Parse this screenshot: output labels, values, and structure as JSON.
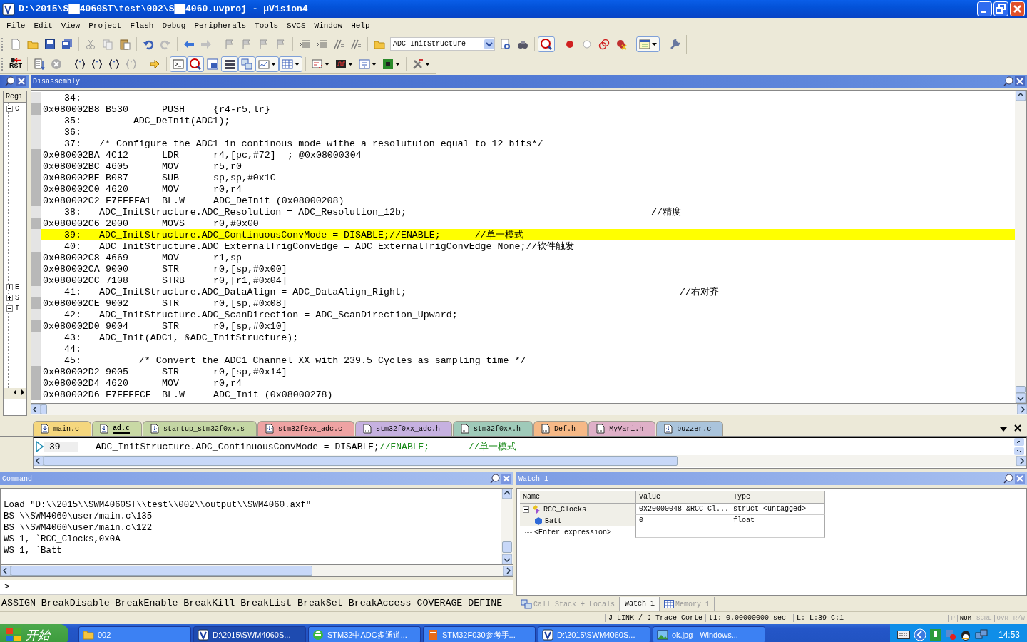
{
  "window": {
    "title": "D:\\2015\\S██4060ST\\test\\002\\S██4060.uvproj - µVision4"
  },
  "menu": [
    "File",
    "Edit",
    "View",
    "Project",
    "Flash",
    "Debug",
    "Peripherals",
    "Tools",
    "SVCS",
    "Window",
    "Help"
  ],
  "toolbar": {
    "combo_value": "ADC_InitStructure",
    "reset_label": "RST"
  },
  "registers_panel": {
    "tab": "Regi",
    "tree": [
      {
        "label": "C",
        "expanded": true
      },
      {
        "label": "E",
        "expanded": false
      },
      {
        "label": "S",
        "expanded": false
      },
      {
        "label": "I",
        "expanded": true
      }
    ]
  },
  "disassembly": {
    "title": "Disassembly",
    "lines": [
      {
        "kind": "src",
        "num": "34:",
        "selected": false
      },
      {
        "kind": "asm",
        "address": "0x080002B8",
        "opcode": "B530",
        "mnemonic": "PUSH",
        "operands": "{r4-r5,lr}",
        "selected": false
      },
      {
        "kind": "src",
        "num": "35:",
        "text": "      ADC_DeInit(ADC1);",
        "selected": false
      },
      {
        "kind": "src",
        "num": "36:",
        "selected": false
      },
      {
        "kind": "src",
        "num": "37:",
        "text": "/* Configure the ADC1 in continous mode withe a resolutuion equal to 12 bits*/",
        "selected": false
      },
      {
        "kind": "asm",
        "address": "0x080002BA",
        "opcode": "4C12",
        "mnemonic": "LDR",
        "operands": "r4,[pc,#72]",
        "comment": "; @0x08000304",
        "selected": false
      },
      {
        "kind": "asm",
        "address": "0x080002BC",
        "opcode": "4605",
        "mnemonic": "MOV",
        "operands": "r5,r0",
        "selected": false
      },
      {
        "kind": "asm",
        "address": "0x080002BE",
        "opcode": "B087",
        "mnemonic": "SUB",
        "operands": "sp,sp,#0x1C",
        "selected": false
      },
      {
        "kind": "asm",
        "address": "0x080002C0",
        "opcode": "4620",
        "mnemonic": "MOV",
        "operands": "r0,r4",
        "selected": false
      },
      {
        "kind": "asm",
        "address": "0x080002C2",
        "opcode": "F7FFFFA1",
        "mnemonic": "BL.W",
        "operands": "ADC_DeInit (0x08000208)",
        "selected": false
      },
      {
        "kind": "src",
        "num": "38:",
        "text": "ADC_InitStructure.ADC_Resolution = ADC_Resolution_12b;                                           //精度",
        "selected": false
      },
      {
        "kind": "asm",
        "address": "0x080002C6",
        "opcode": "2000",
        "mnemonic": "MOVS",
        "operands": "r0,#0x00",
        "selected": false
      },
      {
        "kind": "src",
        "num": "39:",
        "text": "ADC_InitStructure.ADC_ContinuousConvMode = DISABLE;//ENABLE;      //单一模式",
        "selected": true
      },
      {
        "kind": "src",
        "num": "40:",
        "text": "ADC_InitStructure.ADC_ExternalTrigConvEdge = ADC_ExternalTrigConvEdge_None;//软件触发",
        "selected": false
      },
      {
        "kind": "asm",
        "address": "0x080002C8",
        "opcode": "4669",
        "mnemonic": "MOV",
        "operands": "r1,sp",
        "selected": false
      },
      {
        "kind": "asm",
        "address": "0x080002CA",
        "opcode": "9000",
        "mnemonic": "STR",
        "operands": "r0,[sp,#0x00]",
        "selected": false
      },
      {
        "kind": "asm",
        "address": "0x080002CC",
        "opcode": "7108",
        "mnemonic": "STRB",
        "operands": "r0,[r1,#0x04]",
        "selected": false
      },
      {
        "kind": "src",
        "num": "41:",
        "text": "ADC_InitStructure.ADC_DataAlign = ADC_DataAlign_Right;                                                //右对齐",
        "selected": false
      },
      {
        "kind": "asm",
        "address": "0x080002CE",
        "opcode": "9002",
        "mnemonic": "STR",
        "operands": "r0,[sp,#0x08]",
        "selected": false
      },
      {
        "kind": "src",
        "num": "42:",
        "text": "ADC_InitStructure.ADC_ScanDirection = ADC_ScanDirection_Upward;",
        "selected": false
      },
      {
        "kind": "asm",
        "address": "0x080002D0",
        "opcode": "9004",
        "mnemonic": "STR",
        "operands": "r0,[sp,#0x10]",
        "selected": false
      },
      {
        "kind": "src",
        "num": "43:",
        "text": "ADC_Init(ADC1, &ADC_InitStructure);",
        "selected": false
      },
      {
        "kind": "src",
        "num": "44:",
        "selected": false
      },
      {
        "kind": "src",
        "num": "45:",
        "text": "       /* Convert the ADC1 Channel XX with 239.5 Cycles as sampling time */",
        "selected": false
      },
      {
        "kind": "asm",
        "address": "0x080002D2",
        "opcode": "9005",
        "mnemonic": "STR",
        "operands": "r0,[sp,#0x14]",
        "selected": false
      },
      {
        "kind": "asm",
        "address": "0x080002D4",
        "opcode": "4620",
        "mnemonic": "MOV",
        "operands": "r0,r4",
        "selected": false
      },
      {
        "kind": "asm",
        "address": "0x080002D6",
        "opcode": "F7FFFFCF",
        "mnemonic": "BL.W",
        "operands": "ADC_Init (0x08000278)",
        "selected": false
      }
    ]
  },
  "file_tabs": [
    {
      "label": "main.c",
      "kind": "c",
      "color": "#f5d77e",
      "selected": false
    },
    {
      "label": "ad.c",
      "kind": "c",
      "color": "#c9d9a5",
      "selected": true
    },
    {
      "label": "startup_stm32f0xx.s",
      "kind": "c",
      "color": "#c4d6a4",
      "selected": false
    },
    {
      "label": "stm32f0xx_adc.c",
      "kind": "c",
      "color": "#eea3a3",
      "selected": false
    },
    {
      "label": "stm32f0xx_adc.h",
      "kind": "h",
      "color": "#c6b1e0",
      "selected": false
    },
    {
      "label": "stm32f0xx.h",
      "kind": "h",
      "color": "#9fcab9",
      "selected": false
    },
    {
      "label": "Def.h",
      "kind": "h",
      "color": "#f6b987",
      "selected": false
    },
    {
      "label": "MyVari.h",
      "kind": "h",
      "color": "#dfb0c8",
      "selected": false
    },
    {
      "label": "buzzer.c",
      "kind": "c",
      "color": "#aac4dc",
      "selected": false
    }
  ],
  "editor": {
    "line_number": "39",
    "code": "ADC_InitStructure.ADC_ContinuousConvMode = DISABLE;",
    "comment": "//ENABLE;       //单一模式"
  },
  "command": {
    "title": "Command",
    "output": [
      "Load \"D:\\\\2015\\\\SWM4060ST\\\\test\\\\002\\\\output\\\\SWM4060.axf\"",
      "BS \\\\SWM4060\\user/main.c\\135",
      "BS \\\\SWM4060\\user/main.c\\122",
      "WS 1, `RCC_Clocks,0x0A",
      "WS 1, `Batt"
    ],
    "prompt": ">",
    "hints": "ASSIGN BreakDisable BreakEnable BreakKill BreakList BreakSet BreakAccess COVERAGE DEFINE"
  },
  "watch": {
    "title": "Watch 1",
    "columns": [
      "Name",
      "Value",
      "Type"
    ],
    "rows": [
      {
        "kind": "struct",
        "name": "RCC_Clocks",
        "value": "0x20000048 &RCC_Cl...",
        "type": "struct <untagged>",
        "expanded": false
      },
      {
        "kind": "var",
        "name": "Batt",
        "value": "0",
        "type": "float"
      },
      {
        "kind": "placeholder",
        "name": "<Enter expression>"
      }
    ]
  },
  "bottom_tabs": [
    {
      "label": "Call Stack + Locals",
      "kind": "stack",
      "selected": false
    },
    {
      "label": "Watch 1",
      "kind": "watch",
      "selected": true
    },
    {
      "label": "Memory 1",
      "kind": "memory",
      "selected": false
    }
  ],
  "status_bar": {
    "target": "J-LINK / J-Trace Corte",
    "time": "t1: 0.00000000 sec",
    "position": "L:-L:39 C:1",
    "indicators": [
      {
        "label": "P",
        "on": false
      },
      {
        "label": "NUM",
        "on": true
      },
      {
        "label": "SCRL",
        "on": false
      },
      {
        "label": "OVR",
        "on": false
      },
      {
        "label": "R/W",
        "on": false
      }
    ]
  },
  "taskbar": {
    "start": "开始",
    "tasks": [
      {
        "label": "002",
        "kind": "folder",
        "selected": false
      },
      {
        "label": "D:\\2015\\SWM4060S...",
        "kind": "uvision",
        "selected": true
      },
      {
        "label": "STM32中ADC多通道...",
        "kind": "browser",
        "selected": false
      },
      {
        "label": "STM32F030参考手...",
        "kind": "pdf",
        "selected": false
      },
      {
        "label": "D:\\2015\\SWM4060S...",
        "kind": "uvision",
        "selected": false
      },
      {
        "label": "ok.jpg - Windows...",
        "kind": "image",
        "selected": false
      }
    ],
    "clock": "14:53"
  }
}
